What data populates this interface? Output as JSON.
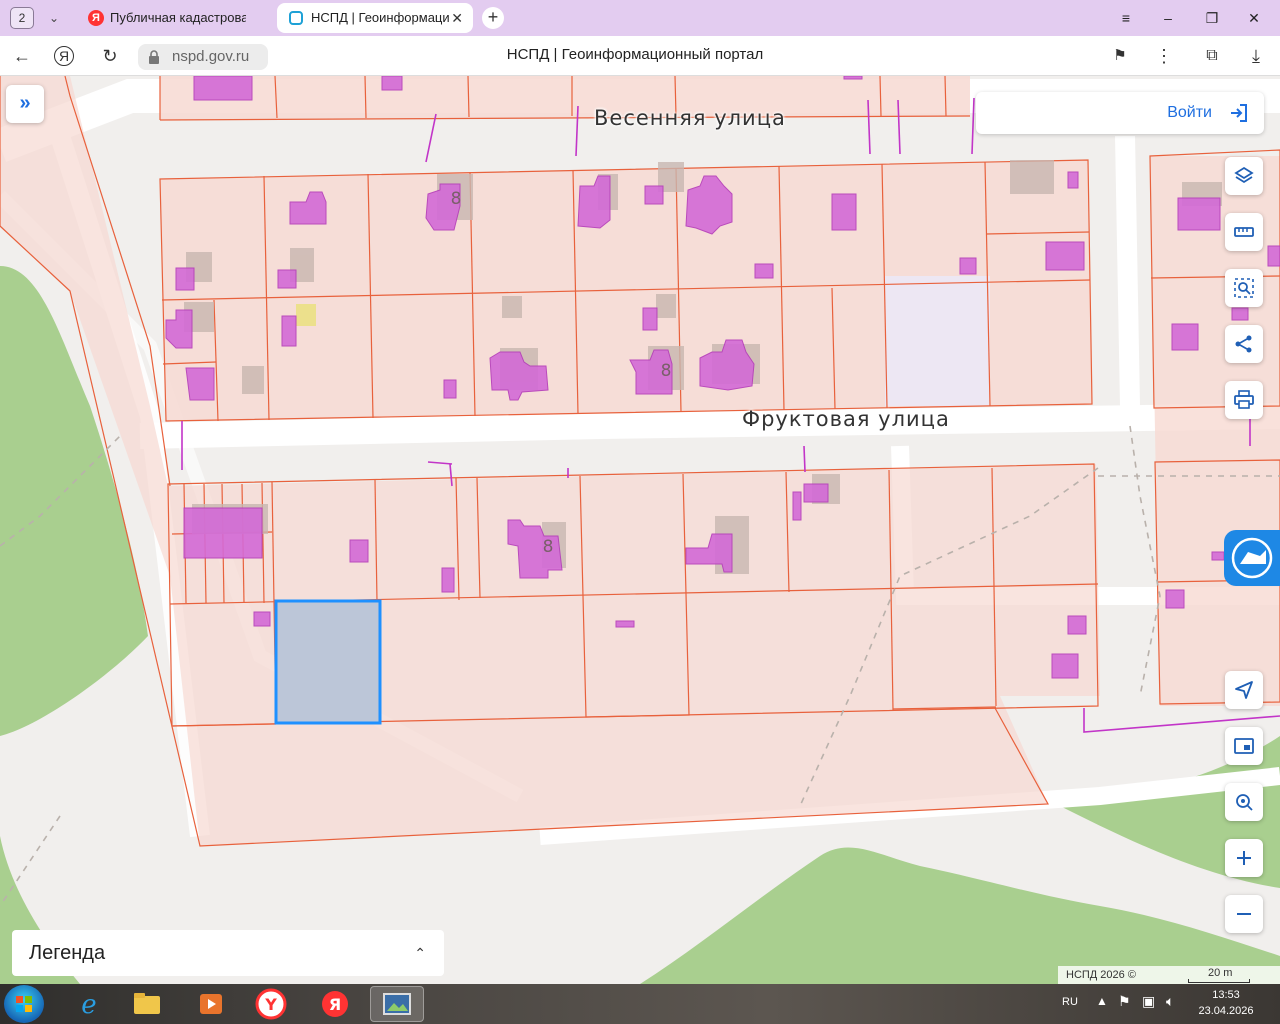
{
  "browser": {
    "tab_count": "2",
    "tabs": [
      {
        "title": "Публичная кадастровая к",
        "active": false
      },
      {
        "title": "НСПД | Геоинформаци",
        "active": true
      }
    ],
    "url": "nspd.gov.ru",
    "page_title": "НСПД | Геоинформационный портал"
  },
  "map": {
    "streets": [
      "Весенняя улица",
      "Фруктовая улица"
    ],
    "house_numbers": [
      "8",
      "8",
      "8"
    ],
    "login_label": "Войти",
    "legend_label": "Легенда",
    "attribution": "НСПД 2026 ©",
    "scale_label": "20 m",
    "colors": {
      "parcel_line": "#e8613c",
      "parcel_fill": "#f7d9d2",
      "building": "#d36ad6",
      "selected": "#1e90ff",
      "forest": "#a9cf8f"
    }
  },
  "taskbar": {
    "language": "RU",
    "time": "13:53",
    "date": "23.04.2026"
  }
}
